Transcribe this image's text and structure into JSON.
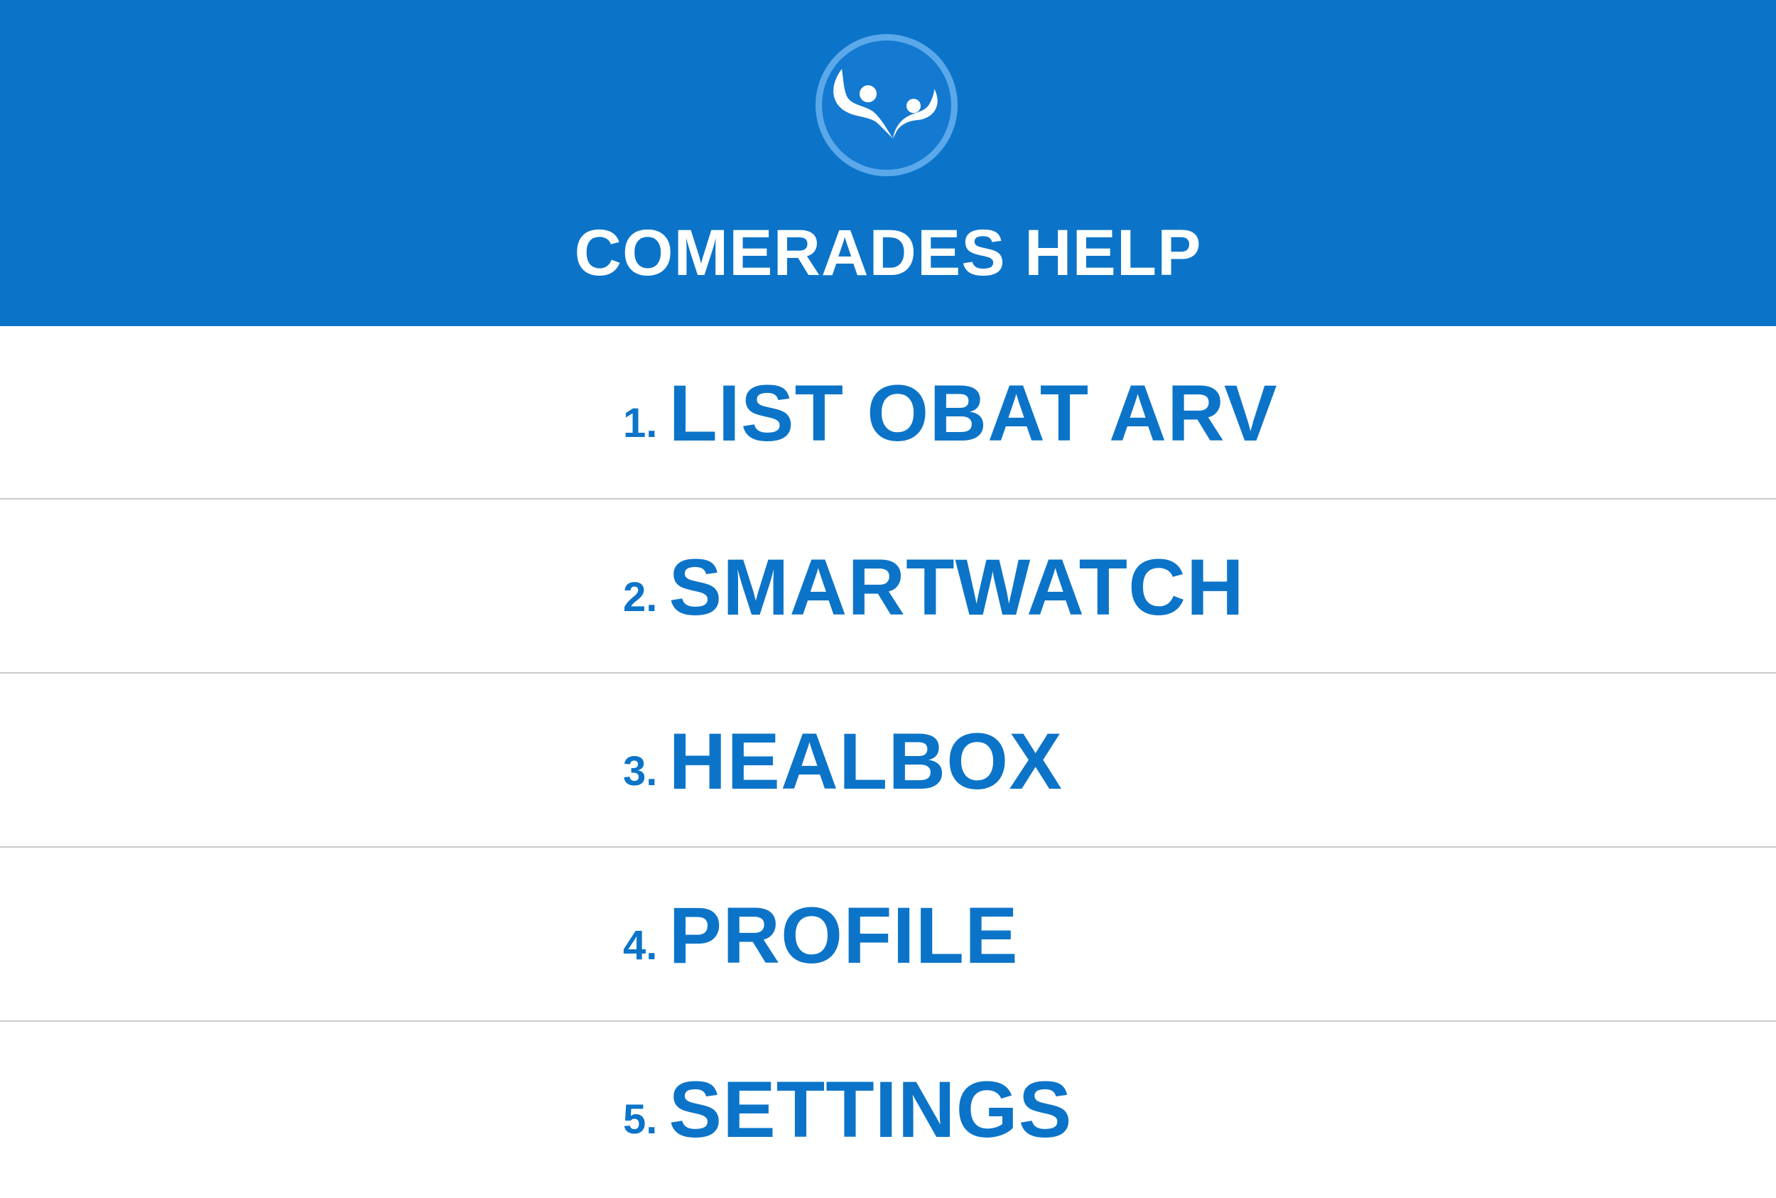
{
  "header": {
    "title": "COMERADES HELP",
    "background_color": "#0C74C8",
    "logo_icon": "people-heart-logo-icon"
  },
  "menu": {
    "accent_color": "#0C74C8",
    "items": [
      {
        "number": "1.",
        "label": "LIST OBAT ARV"
      },
      {
        "number": "2.",
        "label": "SMARTWATCH"
      },
      {
        "number": "3.",
        "label": "HEALBOX"
      },
      {
        "number": "4.",
        "label": "PROFILE"
      },
      {
        "number": "5.",
        "label": "SETTINGS"
      }
    ]
  }
}
